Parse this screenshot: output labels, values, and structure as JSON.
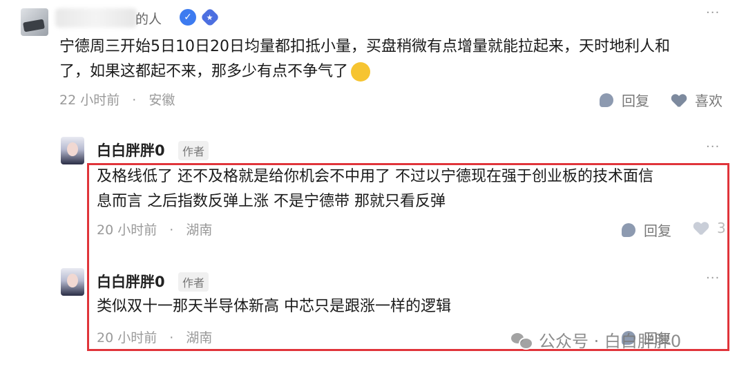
{
  "main_comment": {
    "username_visible_suffix": "的人",
    "icons": [
      "verified-icon",
      "level-badge-icon",
      "more-icon",
      "emoji-icon"
    ],
    "content_line1": "宁德周三开始5日10日20日均量都扣抵小量，买盘稍微有点增量就能拉起来，天时地利人和",
    "content_line2": "了，如果这都起不来，那多少有点不争气了",
    "time": "22 小时前",
    "separator": "·",
    "location": "安徽",
    "reply_label": "回复",
    "like_label": "喜欢"
  },
  "replies": [
    {
      "username": "白白胖胖0",
      "tag": "作者",
      "content_line1": "及格线低了 还不及格就是给你机会不中用了 不过以宁德现在强于创业板的技术面信",
      "content_line2": "息而言 之后指数反弹上涨 不是宁德带 那就只看反弹",
      "time": "20 小时前",
      "separator": "·",
      "location": "湖南",
      "reply_label": "回复",
      "like_count": "3"
    },
    {
      "username": "白白胖胖0",
      "tag": "作者",
      "content_line1": "类似双十一那天半导体新高 中芯只是跟涨一样的逻辑",
      "time": "20 小时前",
      "separator": "·",
      "location": "湖南",
      "reply_label": "回复"
    }
  ],
  "watermark": {
    "text": "公众号 · 白白胖胖0"
  },
  "colors": {
    "highlight_border": "#e0343a",
    "verified_blue": "#3d7bf0",
    "meta_gray": "#999999"
  }
}
